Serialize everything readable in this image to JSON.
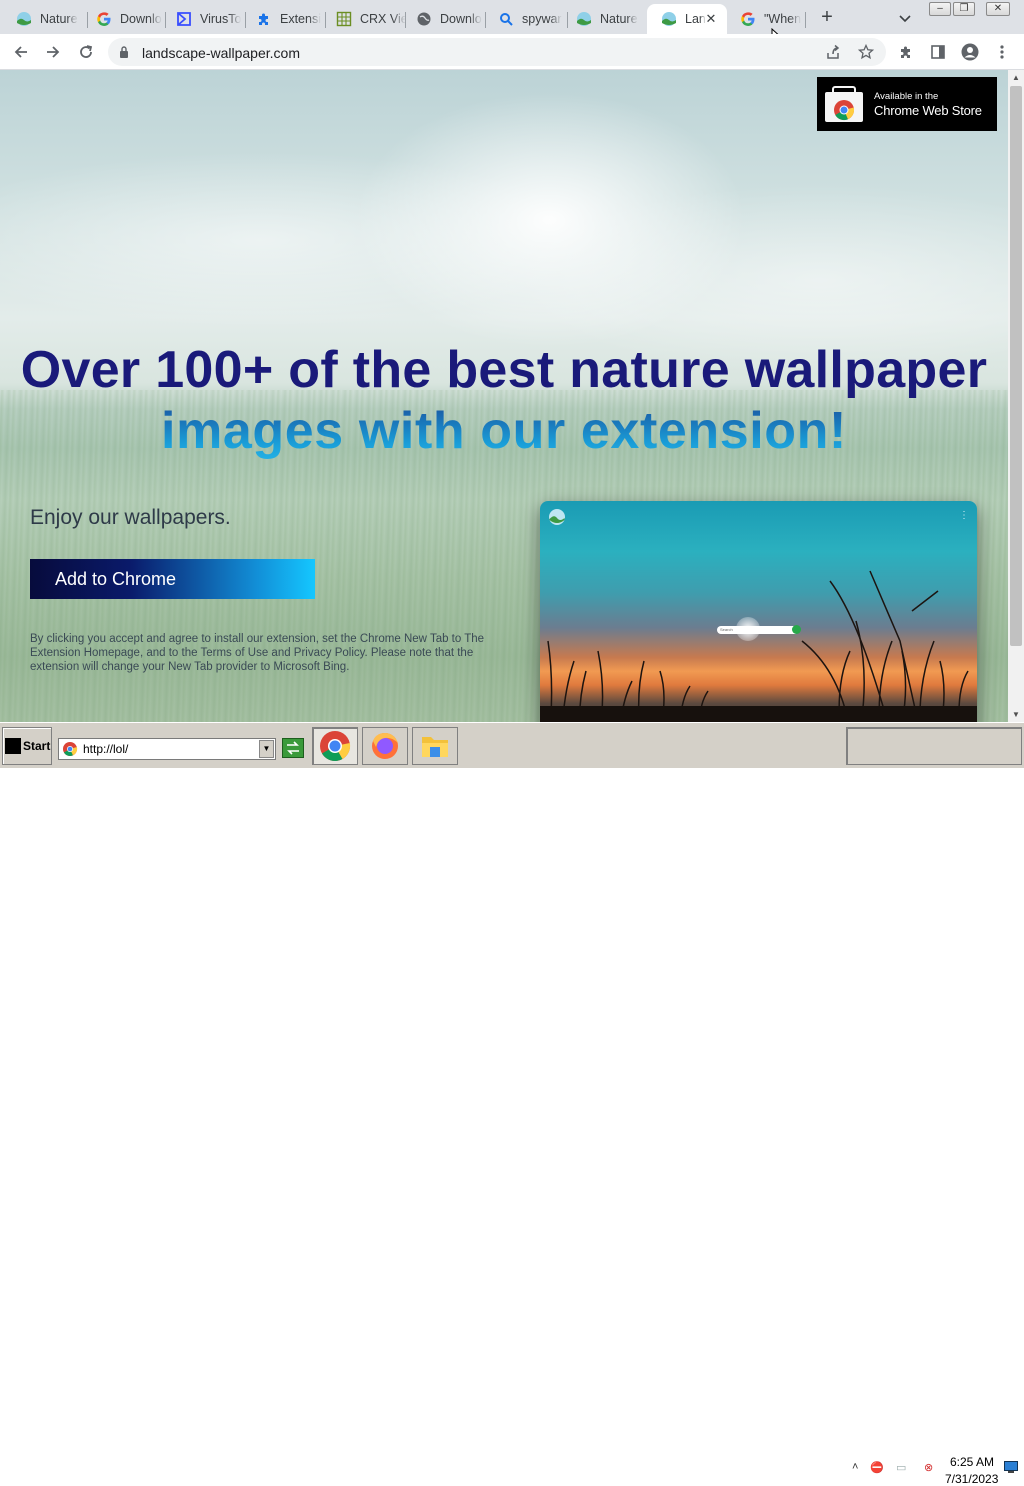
{
  "tabs": [
    {
      "title": "Nature",
      "icon": "landscape-favicon-icon"
    },
    {
      "title": "Downlo",
      "icon": "google-icon"
    },
    {
      "title": "VirusTo",
      "icon": "virustotal-icon"
    },
    {
      "title": "Extensi",
      "icon": "puzzle-icon"
    },
    {
      "title": "CRX Vie",
      "icon": "crx-viewer-icon"
    },
    {
      "title": "Downlo",
      "icon": "globe-icon"
    },
    {
      "title": "spywar",
      "icon": "search-icon"
    },
    {
      "title": "Nature",
      "icon": "landscape-favicon-icon"
    },
    {
      "title": "Lan",
      "icon": "landscape-favicon-icon",
      "active": true
    },
    {
      "title": "\"When",
      "icon": "google-icon"
    }
  ],
  "browser": {
    "url": "landscape-wallpaper.com"
  },
  "page": {
    "cws_badge_small": "Available in the",
    "cws_badge_big": "Chrome Web Store",
    "headline_line1": "Over 100+ of the best nature wallpaper",
    "headline_line2": "images with our extension!",
    "tagline": "Enjoy our wallpapers.",
    "cta_label": "Add to Chrome",
    "disclaimer": "By clicking you accept and agree to install our extension, set the Chrome New Tab to The Extension Homepage, and to the Terms of Use and Privacy Policy. Please note that the extension will change your New Tab provider to Microsoft Bing.",
    "preview_search_placeholder": "Search"
  },
  "taskbar": {
    "start_label": "Start",
    "address_value": "http://lol/",
    "time": "6:25 AM",
    "date": "7/31/2023",
    "apps": [
      "chrome-icon",
      "firefox-icon",
      "file-explorer-icon"
    ]
  }
}
